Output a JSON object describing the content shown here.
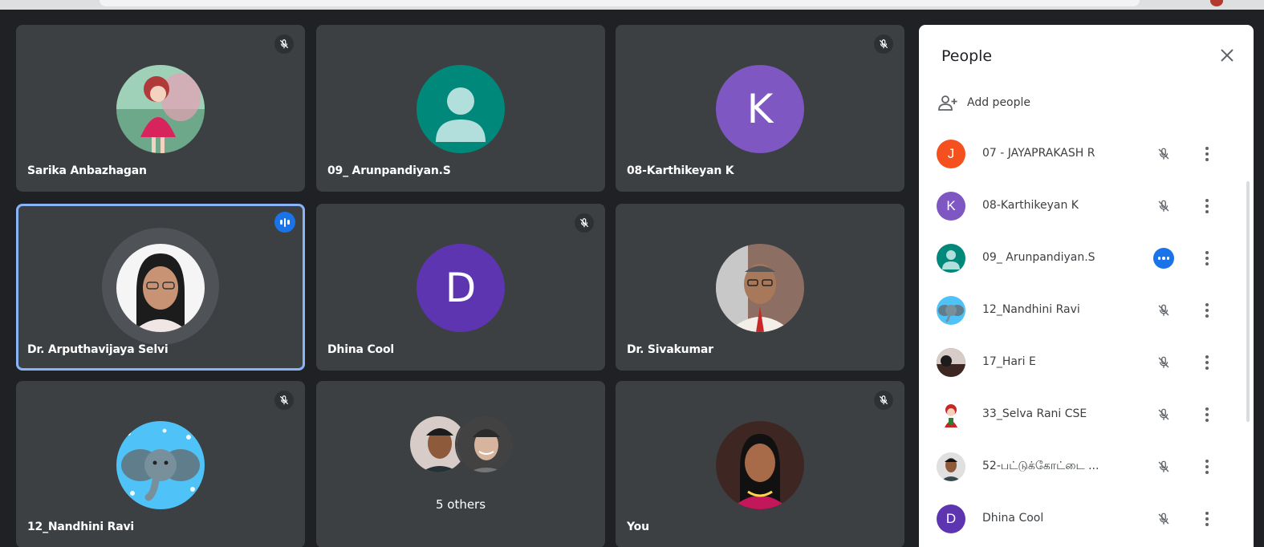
{
  "tiles": [
    {
      "name": "Sarika Anbazhagan",
      "icon": "doll-photo",
      "muted": true
    },
    {
      "name": "09_ Arunpandiyan.S",
      "icon": "default-person",
      "muted": false
    },
    {
      "name": "08-Karthikeyan K",
      "letter": "K",
      "color": "#7e57c2",
      "muted": true
    },
    {
      "name": "Dr. Arputhavijaya Selvi",
      "icon": "profile-photo",
      "speaking": true
    },
    {
      "name": "Dhina Cool",
      "letter": "D",
      "color": "#5e35b1",
      "muted": true
    },
    {
      "name": "Dr. Sivakumar",
      "icon": "profile-photo",
      "muted": false
    },
    {
      "name": "12_Nandhini Ravi",
      "icon": "elephant-photo",
      "muted": true
    },
    {
      "others_label": "5 others"
    },
    {
      "name": "You",
      "icon": "profile-photo",
      "muted": true
    }
  ],
  "panel": {
    "title": "People",
    "add_people": "Add people",
    "participants": [
      {
        "name": "07 - JAYAPRAKASH R",
        "letter": "J",
        "color": "#f4511e",
        "status": "muted"
      },
      {
        "name": "08-Karthikeyan K",
        "letter": "K",
        "color": "#7e57c2",
        "status": "muted"
      },
      {
        "name": "09_ Arunpandiyan.S",
        "icon": "default-person",
        "color": "#00897b",
        "status": "more"
      },
      {
        "name": "12_Nandhini Ravi",
        "icon": "elephant-photo",
        "status": "muted"
      },
      {
        "name": "17_Hari E",
        "icon": "photo",
        "status": "muted"
      },
      {
        "name": "33_Selva Rani CSE",
        "icon": "cartoon-photo",
        "status": "muted"
      },
      {
        "name": "52-பட்டுக்கோட்டை ...",
        "icon": "photo",
        "status": "muted"
      },
      {
        "name": "Dhina Cool",
        "letter": "D",
        "color": "#5e35b1",
        "status": "muted"
      }
    ]
  }
}
